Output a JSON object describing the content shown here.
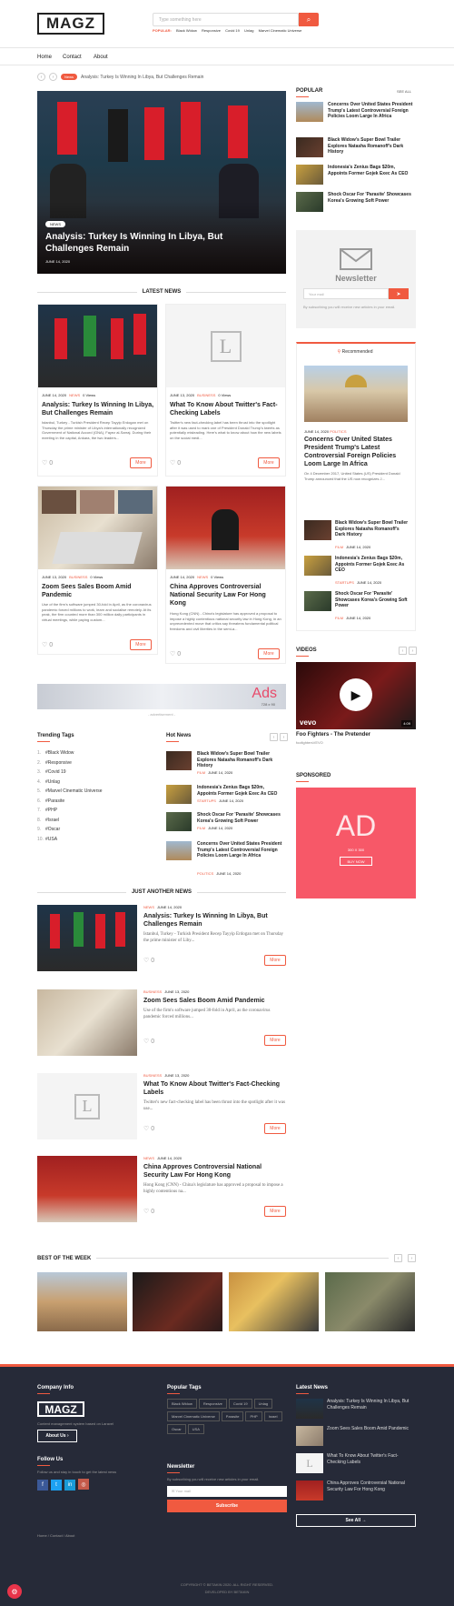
{
  "header": {
    "logo": "MAGZ",
    "search_placeholder": "Type something here",
    "popular_label": "POPULAR:",
    "popular_tags": [
      "Black Widow",
      "Responsive",
      "Covid 19",
      "Unlag",
      "Marvel Cinematic Universe"
    ]
  },
  "nav": {
    "items": [
      "Home",
      "Contact",
      "About"
    ]
  },
  "breadcrumb": {
    "badge": "News",
    "text": "Analysis: Turkey Is Winning In Libya, But Challenges Remain"
  },
  "hero": {
    "tag": "NEWS",
    "title": "Analysis: Turkey Is Winning In Libya, But Challenges Remain",
    "date": "JUNE 14, 2020"
  },
  "latest": {
    "title": "LATEST NEWS",
    "cards": [
      {
        "date": "JUNE 14, 2020",
        "cat": "NEWS",
        "views": "0 Views",
        "title": "Analysis: Turkey Is Winning In Libya, But Challenges Remain",
        "excerpt": "Istanbul, Turkey - Turkish President Recep Tayyip Erdogan met on Thursday the prime minister of Libya's internationally recognized Government of National Accord (GNA), Fayez al-Sarraj. During their meeting in the capital, Ankara, the two leaders...",
        "likes": "0",
        "more": "More"
      },
      {
        "date": "JUNE 13, 2020",
        "cat": "BUSINESS",
        "views": "0 Views",
        "title": "What To Know About Twitter's Fact-Checking Labels",
        "excerpt": "Twitter's new fact-checking label has been thrust into the spotlight after it was used to mark one of President Donald Trump's tweets as potentially misleading. Here's what to know about how the new labels on the social medi...",
        "likes": "0",
        "more": "More"
      },
      {
        "date": "JUNE 13, 2020",
        "cat": "BUSINESS",
        "views": "0 Views",
        "title": "Zoom Sees Sales Boom Amid Pandemic",
        "excerpt": "Use of the firm's software jumped 30-fold in April, as the coronavirus pandemic forced millions to work, learn and socialise remotely. At its peak, the firm counted more than 300 million daily participants in virtual meetings, while paying custom...",
        "likes": "0",
        "more": "More"
      },
      {
        "date": "JUNE 14, 2020",
        "cat": "NEWS",
        "views": "0 Views",
        "title": "China Approves Controversial National Security Law For Hong Kong",
        "excerpt": "Hong Kong (CNN) - China's legislature has approved a proposal to impose a highly contentious national security law in Hong Kong, in an unprecedented move that critics say threatens fundamental political freedoms and civil liberties in the semi-a...",
        "likes": "0",
        "more": "More"
      }
    ]
  },
  "banner_ad": {
    "text": "Ads",
    "sub": "728 x 90",
    "caption": "- advertisement -"
  },
  "trending": {
    "title": "Trending Tags",
    "tags": [
      "#Black Widow",
      "#Responsive",
      "#Covid 19",
      "#Unlag",
      "#Marvel Cinematic Universe",
      "#Parasite",
      "#PHP",
      "#Israel",
      "#Oscar",
      "#USA"
    ]
  },
  "hot": {
    "title": "Hot News",
    "items": [
      {
        "title": "Black Widow's Super Bowl Trailer Explores Natasha Romanoff's Dark History",
        "cat": "FILM",
        "date": "JUNE 14, 2020"
      },
      {
        "title": "Indonesia's Zenius Bags $20m, Appoints Former Gojek Exec As CEO",
        "cat": "STARTUPS",
        "date": "JUNE 14, 2020"
      },
      {
        "title": "Shock Oscar For 'Parasite' Showcases Korea's Growing Soft Power",
        "cat": "FILM",
        "date": "JUNE 14, 2020"
      },
      {
        "title": "Concerns Over United States President Trump's Latest Controversial Foreign Policies Loom Large In Africa",
        "cat": "POLITICS",
        "date": "JUNE 14, 2020"
      }
    ]
  },
  "just_another": {
    "title": "JUST ANOTHER NEWS",
    "items": [
      {
        "cat": "NEWS",
        "date": "JUNE 14, 2020",
        "title": "Analysis: Turkey Is Winning In Libya, But Challenges Remain",
        "excerpt": "Istanbul, Turkey - Turkish President Recep Tayyip Erdogan met on Thursday the prime minister of Liby...",
        "likes": "0",
        "more": "More"
      },
      {
        "cat": "BUSINESS",
        "date": "JUNE 13, 2020",
        "title": "Zoom Sees Sales Boom Amid Pandemic",
        "excerpt": "Use of the firm's software jumped 30-fold in April, as the coronavirus pandemic forced millions...",
        "likes": "0",
        "more": "More"
      },
      {
        "cat": "BUSINESS",
        "date": "JUNE 13, 2020",
        "title": "What To Know About Twitter's Fact-Checking Labels",
        "excerpt": "Twitter's new fact-checking label has been thrust into the spotlight after it was use...",
        "likes": "0",
        "more": "More"
      },
      {
        "cat": "NEWS",
        "date": "JUNE 14, 2020",
        "title": "China Approves Controversial National Security Law For Hong Kong",
        "excerpt": "Hong Kong (CNN) - China's legislature has approved a proposal to impose a highly contentious na...",
        "likes": "0",
        "more": "More"
      }
    ]
  },
  "best": {
    "title": "BEST OF THE WEEK"
  },
  "sidebar": {
    "popular_title": "POPULAR",
    "see_all": "SEE ALL",
    "popular": [
      "Concerns Over United States President Trump's Latest Controversial Foreign Policies Loom Large In Africa",
      "Black Widow's Super Bowl Trailer Explores Natasha Romanoff's Dark History",
      "Indonesia's Zenius Bags $20m, Appoints Former Gojek Exec As CEO",
      "Shock Oscar For 'Parasite' Showcases Korea's Growing Soft Power"
    ],
    "newsletter": {
      "title": "Newsletter",
      "placeholder": "Your mail",
      "note": "By subscribing you will receive new articles in your email."
    },
    "recommended": {
      "title": "Recommended",
      "main": {
        "date": "JUNE 14, 2020",
        "cat": "POLITICS",
        "title": "Concerns Over United States President Trump's Latest Controversial Foreign Policies Loom Large In Africa",
        "excerpt": "On 4 December 2017, United States (US) President Donald Trump announced that the US now recognizes J..."
      },
      "items": [
        {
          "title": "Black Widow's Super Bowl Trailer Explores Natasha Romanoff's Dark History",
          "cat": "FILM",
          "date": "JUNE 14, 2020"
        },
        {
          "title": "Indonesia's Zenius Bags $20m, Appoints Former Gojek Exec As CEO",
          "cat": "STARTUPS",
          "date": "JUNE 14, 2020"
        },
        {
          "title": "Shock Oscar For 'Parasite' Showcases Korea's Growing Soft Power",
          "cat": "FILM",
          "date": "JUNE 14, 2020"
        }
      ]
    },
    "videos": {
      "title": "VIDEOS",
      "label": "vevo",
      "duration": "4:09",
      "video_title": "Foo Fighters - The Pretender",
      "channel": "foofightersVEVO"
    },
    "sponsored": {
      "title": "SPONSORED",
      "ad": "AD",
      "size": "300 X 300",
      "button": "BUY NOW"
    }
  },
  "footer": {
    "company_title": "Company Info",
    "logo": "MAGZ",
    "desc": "Content management system based on Laravel",
    "about_btn": "About Us",
    "follow_title": "Follow Us",
    "follow_text": "Follow us and stay in touch to get the latest news",
    "links": [
      "Home",
      "Contact",
      "About"
    ],
    "tags_title": "Popular Tags",
    "tags": [
      "Black Widow",
      "Responsive",
      "Covid 19",
      "Unlag",
      "Marvel Cinematic Universe",
      "Parasite",
      "PHP",
      "Israel",
      "Oscar",
      "USA"
    ],
    "newsletter_title": "Newsletter",
    "newsletter_text": "By subscribing you will receive new articles in your email.",
    "newsletter_placeholder": "Your mail",
    "subscribe": "Subscribe",
    "latest_title": "Latest News",
    "latest": [
      "Analysis: Turkey Is Winning In Libya, But Challenges Remain",
      "Zoom Sees Sales Boom Amid Pandemic",
      "What To Know About Twitter's Fact-Checking Labels",
      "China Approves Controversial National Security Law For Hong Kong"
    ],
    "see_all": "See All",
    "copyright": "COPYRIGHT © BETAKIN 2020. ALL RIGHT RESERVED.",
    "developed": "DEVELOPED BY BETAKIN"
  },
  "colors": {
    "accent": "#f05a40",
    "footer_bg": "#262a38"
  }
}
